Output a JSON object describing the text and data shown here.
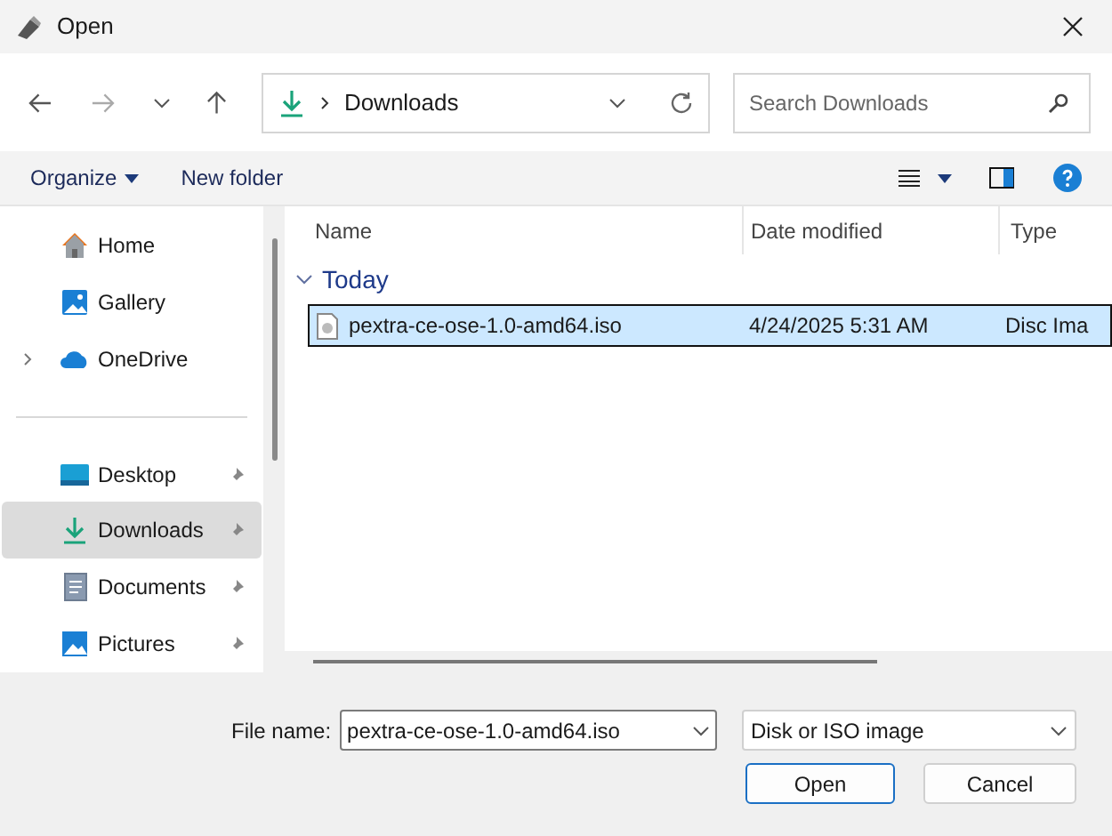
{
  "window": {
    "title": "Open"
  },
  "address_bar": {
    "location": "Downloads"
  },
  "search": {
    "placeholder": "Search Downloads"
  },
  "toolbar": {
    "organize": "Organize",
    "new_folder": "New folder"
  },
  "sidebar": {
    "items": [
      {
        "label": "Home",
        "kind": "home",
        "selected": false,
        "pinned": false,
        "expandable": false
      },
      {
        "label": "Gallery",
        "kind": "gallery",
        "selected": false,
        "pinned": false,
        "expandable": false
      },
      {
        "label": "OneDrive",
        "kind": "cloud",
        "selected": false,
        "pinned": false,
        "expandable": true
      },
      {
        "kind": "separator"
      },
      {
        "label": "Desktop",
        "kind": "desktop",
        "selected": false,
        "pinned": true,
        "expandable": false
      },
      {
        "label": "Downloads",
        "kind": "download",
        "selected": true,
        "pinned": true,
        "expandable": false
      },
      {
        "label": "Documents",
        "kind": "document",
        "selected": false,
        "pinned": true,
        "expandable": false
      },
      {
        "label": "Pictures",
        "kind": "picture",
        "selected": false,
        "pinned": true,
        "expandable": false
      }
    ]
  },
  "table": {
    "columns": [
      "Name",
      "Date modified",
      "Type"
    ],
    "groups": [
      {
        "label": "Today",
        "expanded": true,
        "rows": [
          {
            "name": "pextra-ce-ose-1.0-amd64.iso",
            "date": "4/24/2025 5:31 AM",
            "type": "Disc Ima",
            "selected": true
          }
        ]
      }
    ]
  },
  "footer": {
    "file_name_label": "File name:",
    "file_name": "pextra-ce-ose-1.0-amd64.iso",
    "file_type": "Disk or ISO image",
    "buttons": [
      "Open",
      "Cancel"
    ]
  }
}
